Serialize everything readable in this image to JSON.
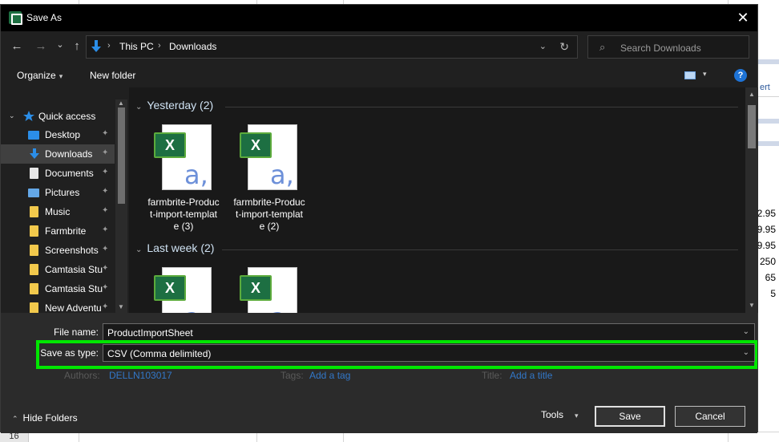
{
  "background": {
    "cell_values": [
      "2.95",
      "9.95",
      "9.95",
      "250",
      "65",
      "5"
    ],
    "insert_label": "ert",
    "row_number": "16"
  },
  "dialog": {
    "title": "Save As",
    "close_glyph": "✕"
  },
  "navbar": {
    "back_glyph": "←",
    "forward_glyph": "→",
    "recent_glyph": "⌄",
    "up_glyph": "↑",
    "breadcrumb": [
      "This PC",
      "Downloads"
    ],
    "breadcrumb_sep": "›",
    "address_dropdown": "⌄",
    "refresh_glyph": "↻",
    "search_placeholder": "Search Downloads",
    "search_glyph": "⌕"
  },
  "toolbar": {
    "organize_label": "Organize",
    "new_folder_label": "New folder",
    "help_glyph": "?",
    "caret": "▾"
  },
  "navpane": {
    "quick_access_label": "Quick access",
    "items": [
      {
        "label": "Desktop",
        "icon": "desktop-icon"
      },
      {
        "label": "Downloads",
        "icon": "download-icon"
      },
      {
        "label": "Documents",
        "icon": "documents-icon"
      },
      {
        "label": "Pictures",
        "icon": "pictures-icon"
      },
      {
        "label": "Music",
        "icon": "music-icon"
      },
      {
        "label": "Farmbrite",
        "icon": "folder-icon"
      },
      {
        "label": "Screenshots",
        "icon": "folder-icon"
      },
      {
        "label": "Camtasia Stu",
        "icon": "folder-icon"
      },
      {
        "label": "Camtasia Stu",
        "icon": "folder-icon"
      },
      {
        "label": "New Adventu",
        "icon": "folder-icon"
      }
    ],
    "pin_glyph": "📌"
  },
  "files": {
    "groups": [
      {
        "label": "Yesterday (2)",
        "items": [
          {
            "name_lines": [
              "farmbrite-Produc",
              "t-import-templat",
              "e (3)"
            ]
          },
          {
            "name_lines": [
              "farmbrite-Produc",
              "t-import-templat",
              "e (2)"
            ]
          }
        ]
      },
      {
        "label": "Last week (2)",
        "items": [
          {
            "name_lines": []
          },
          {
            "name_lines": []
          }
        ]
      }
    ],
    "xl_letter": "X",
    "aa_glyph": "a,"
  },
  "form": {
    "file_name_label": "File name:",
    "file_name_value": "ProductImportSheet",
    "save_type_label": "Save as type:",
    "save_type_value": "CSV (Comma delimited)",
    "authors_label": "Authors:",
    "authors_value": "DELLN103017",
    "tags_label": "Tags:",
    "tags_value": "Add a tag",
    "title_label": "Title:",
    "title_value": "Add a title",
    "highlight_color": "#00e600"
  },
  "footer": {
    "hide_folders_label": "Hide Folders",
    "tools_label": "Tools",
    "save_label": "Save",
    "cancel_label": "Cancel"
  }
}
